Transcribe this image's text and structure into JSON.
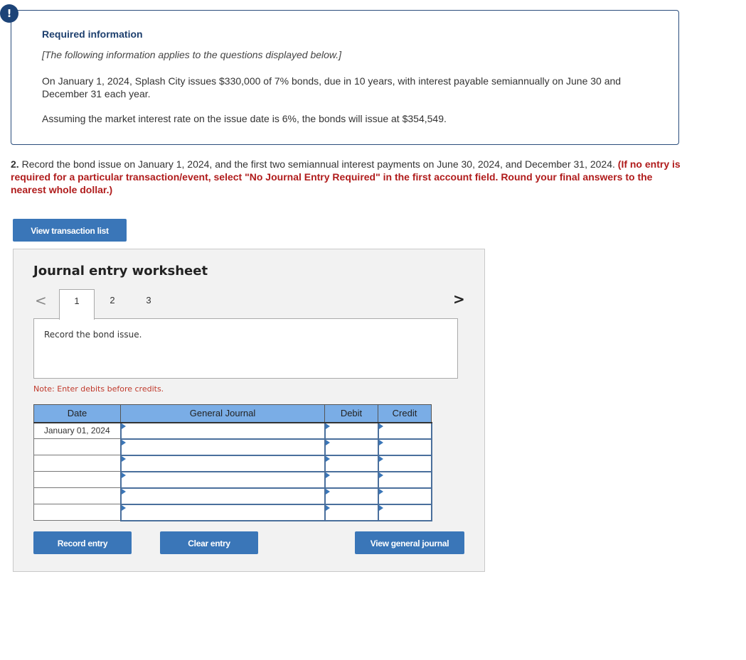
{
  "info": {
    "badge_icon": "!",
    "title": "Required information",
    "italic_note": "[The following information applies to the questions displayed below.]",
    "paragraph1": "On January 1, 2024, Splash City issues $330,000 of 7% bonds, due in 10 years, with interest payable semiannually on June 30 and December 31 each year.",
    "paragraph2": "Assuming the market interest rate on the issue date is 6%, the bonds will issue at $354,549."
  },
  "question": {
    "number": "2.",
    "text": " Record the bond issue on January 1, 2024, and the first two semiannual interest payments on June 30, 2024, and December 31, 2024. ",
    "instruction": "(If no entry is required for a particular transaction/event, select \"No Journal Entry Required\" in the first account field. Round your final answers to the nearest whole dollar.)"
  },
  "buttons": {
    "view_transaction_list": "View transaction list",
    "record_entry": "Record entry",
    "clear_entry": "Clear entry",
    "view_general_journal": "View general journal"
  },
  "worksheet": {
    "title": "Journal entry worksheet",
    "prev_icon": "<",
    "next_icon": ">",
    "tabs": [
      {
        "label": "1",
        "active": true
      },
      {
        "label": "2",
        "active": false
      },
      {
        "label": "3",
        "active": false
      }
    ],
    "instruction": "Record the bond issue.",
    "note": "Note: Enter debits before credits.",
    "table": {
      "headers": [
        "Date",
        "General Journal",
        "Debit",
        "Credit"
      ],
      "rows": [
        {
          "date": "January 01, 2024",
          "account": "",
          "debit": "",
          "credit": ""
        },
        {
          "date": "",
          "account": "",
          "debit": "",
          "credit": ""
        },
        {
          "date": "",
          "account": "",
          "debit": "",
          "credit": ""
        },
        {
          "date": "",
          "account": "",
          "debit": "",
          "credit": ""
        },
        {
          "date": "",
          "account": "",
          "debit": "",
          "credit": ""
        },
        {
          "date": "",
          "account": "",
          "debit": "",
          "credit": ""
        }
      ]
    }
  }
}
